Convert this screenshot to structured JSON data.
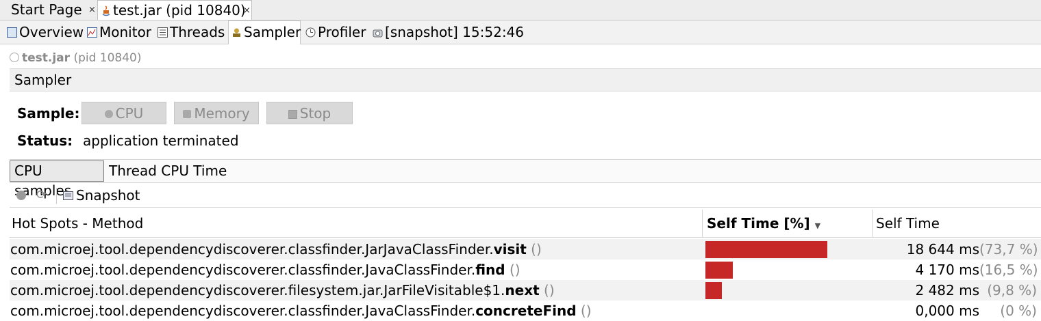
{
  "doc_tabs": [
    {
      "label": "Start Page",
      "close": "×"
    },
    {
      "label": "test.jar (pid 10840)",
      "close": "×"
    }
  ],
  "view_tabs": [
    {
      "label": "Overview",
      "icon": "overview-icon"
    },
    {
      "label": "Monitor",
      "icon": "monitor-icon"
    },
    {
      "label": "Threads",
      "icon": "threads-icon"
    },
    {
      "label": "Sampler",
      "icon": "sampler-icon"
    },
    {
      "label": "Profiler",
      "icon": "profiler-icon"
    },
    {
      "label": "[snapshot] 15:52:46",
      "icon": "snapshot-icon"
    }
  ],
  "process": {
    "name": "test.jar",
    "pid": "(pid 10840)"
  },
  "section_title": "Sampler",
  "sample": {
    "label": "Sample:",
    "buttons": {
      "cpu": "CPU",
      "memory": "Memory",
      "stop": "Stop"
    }
  },
  "status": {
    "label": "Status:",
    "value": "application terminated"
  },
  "result_tabs": {
    "cpu_samples": "CPU samples",
    "thread_cpu": "Thread CPU Time"
  },
  "toolbar": {
    "snapshot": "Snapshot"
  },
  "table": {
    "headers": {
      "method": "Hot Spots - Method",
      "self_pct": "Self Time [%]",
      "self_time": "Self Time"
    },
    "rows": [
      {
        "prefix": "com.microej.tool.dependencydiscoverer.classfinder.JarJavaClassFinder.",
        "method": "visit",
        "suffix": " ()",
        "time": "18 644 ms",
        "pct": "(73,7 %)",
        "fraction": 0.737
      },
      {
        "prefix": "com.microej.tool.dependencydiscoverer.classfinder.JavaClassFinder.",
        "method": "find",
        "suffix": " ()",
        "time": "4 170 ms",
        "pct": "(16,5 %)",
        "fraction": 0.165
      },
      {
        "prefix": "com.microej.tool.dependencydiscoverer.filesystem.jar.JarFileVisitable$1.",
        "method": "next",
        "suffix": " ()",
        "time": "2 482 ms",
        "pct": "(9,8 %)",
        "fraction": 0.098
      },
      {
        "prefix": "com.microej.tool.dependencydiscoverer.classfinder.JavaClassFinder.",
        "method": "concreteFind",
        "suffix": " ()",
        "time": "0,000 ms",
        "pct": "(0 %)",
        "fraction": 0.0
      }
    ]
  },
  "colors": {
    "bar": "#c62828"
  }
}
